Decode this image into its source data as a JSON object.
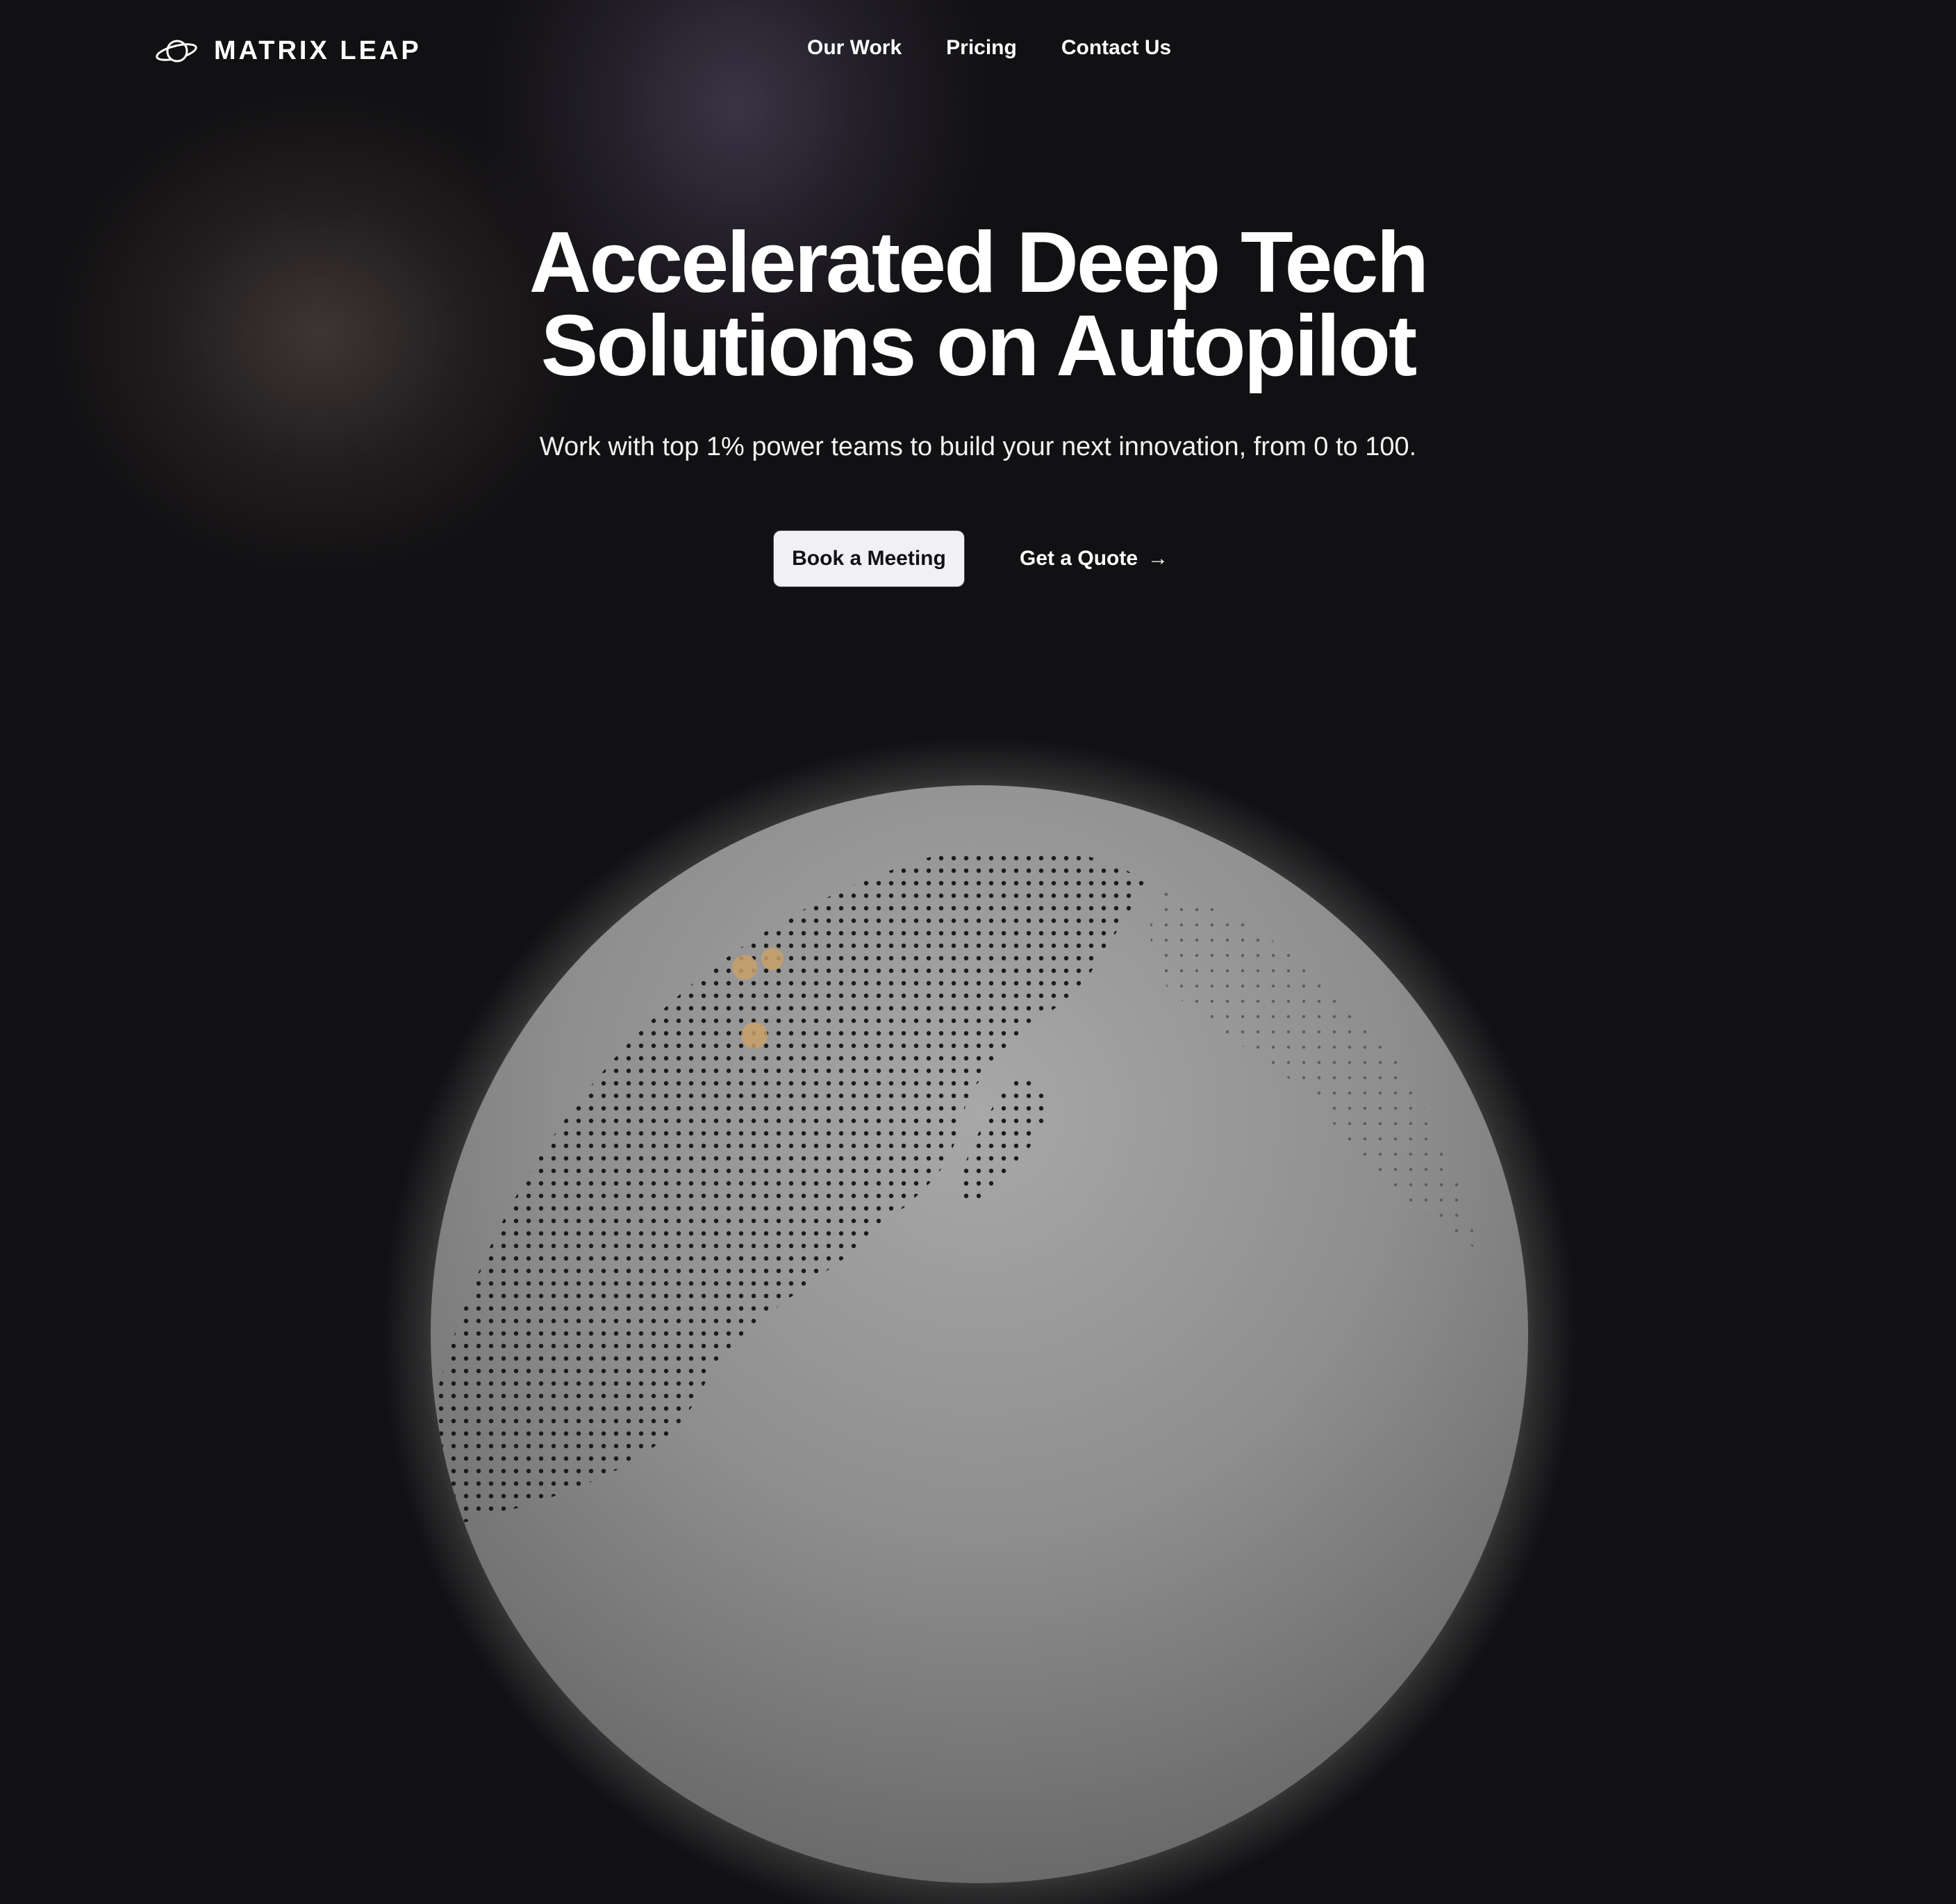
{
  "brand": {
    "name": "MATRIX LEAP",
    "icon": "planet-icon"
  },
  "nav": {
    "links": [
      "Our Work",
      "Pricing",
      "Contact Us"
    ]
  },
  "hero": {
    "title_line1": "Accelerated Deep Tech",
    "title_line2": "Solutions on Autopilot",
    "subtitle": "Work with top 1% power teams to build your next innovation, from 0 to 100.",
    "primary_cta": "Book a Meeting",
    "secondary_cta": "Get a Quote",
    "secondary_icon": "arrow-right-icon"
  },
  "colors": {
    "background": "#111012",
    "button_bg": "#f1f1f4",
    "globe": "#8e8e8e",
    "marker": "#c8a06a"
  }
}
